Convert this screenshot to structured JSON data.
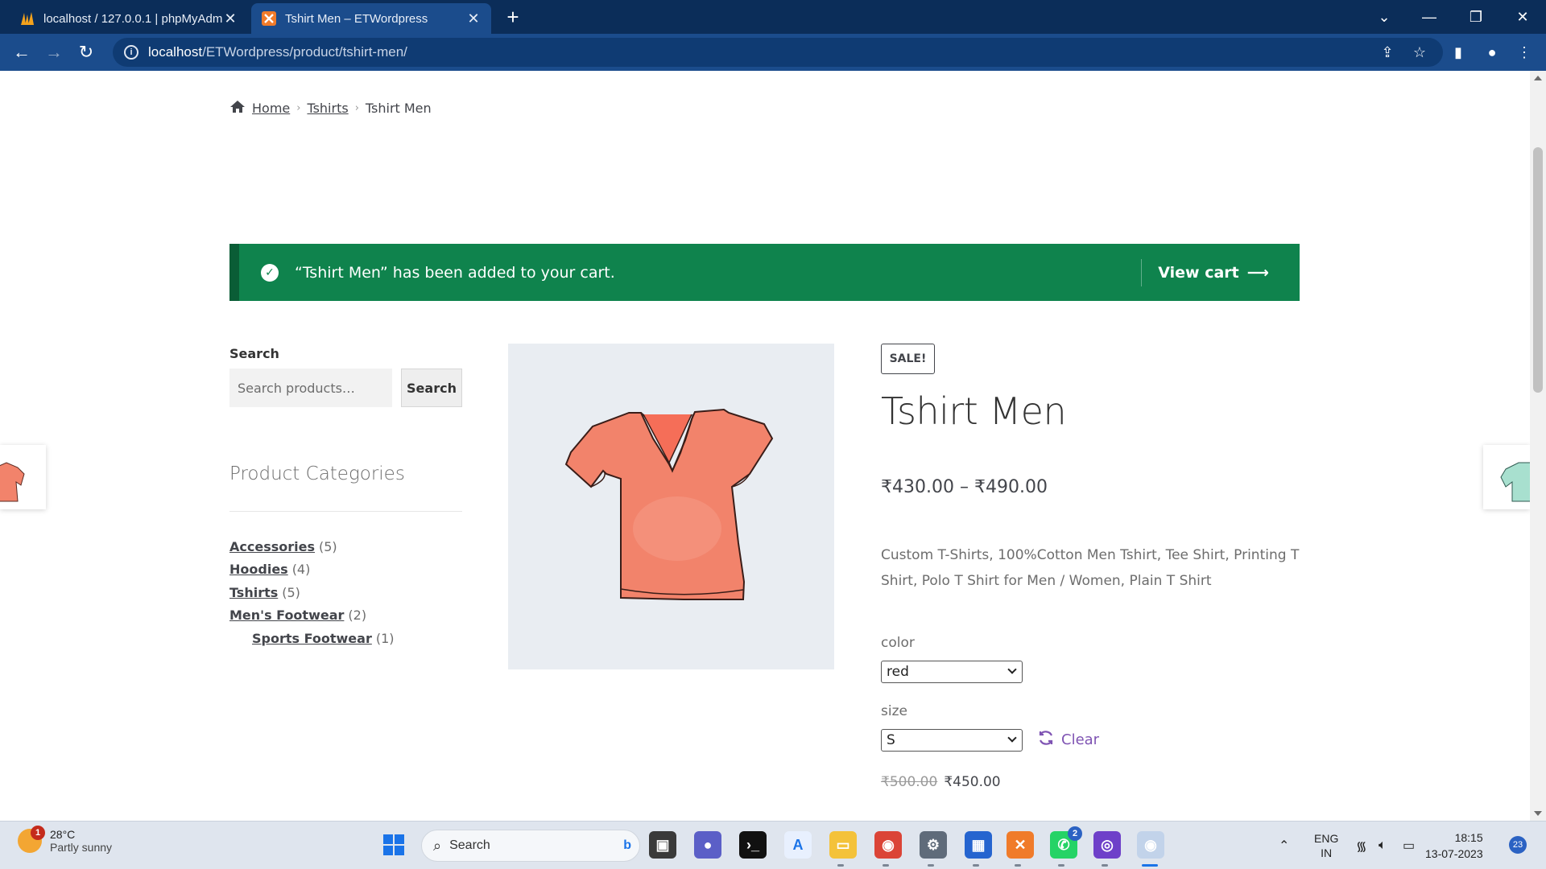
{
  "browser": {
    "tabs": [
      {
        "title": "localhost / 127.0.0.1 | phpMyAdm",
        "close": "✕"
      },
      {
        "title": "Tshirt Men – ETWordpress",
        "close": "✕"
      }
    ],
    "new_tab": "+",
    "url_host": "localhost",
    "url_path": "/ETWordpress/product/tshirt-men/"
  },
  "breadcrumb": {
    "home": "Home",
    "category": "Tshirts",
    "current": "Tshirt Men",
    "separator": "›"
  },
  "notice": {
    "message": "“Tshirt Men” has been added to your cart.",
    "button": "View cart",
    "color": "#0f834d"
  },
  "sidebar": {
    "search_label": "Search",
    "search_placeholder": "Search products…",
    "search_button": "Search",
    "categories_heading": "Product Categories",
    "categories": [
      {
        "name": "Accessories",
        "count": "(5)"
      },
      {
        "name": "Hoodies",
        "count": "(4)"
      },
      {
        "name": "Tshirts",
        "count": "(5)"
      },
      {
        "name": "Men's Footwear",
        "count": "(2)"
      },
      {
        "name": "Sports Footwear",
        "count": "(1)"
      }
    ]
  },
  "product": {
    "badge": "SALE!",
    "title": "Tshirt Men",
    "price_range": "₹430.00 – ₹490.00",
    "description": "Custom T-Shirts, 100%Cotton Men Tshirt, Tee Shirt, Printing T Shirt, Polo T Shirt for Men / Women, Plain T Shirt",
    "color_label": "color",
    "color_value": "red",
    "size_label": "size",
    "size_value": "S",
    "clear": "Clear",
    "old_price": "₹500.00",
    "new_price": "₹450.00",
    "image_color": "#f2836b"
  },
  "taskbar": {
    "weather_temp": "28°C",
    "weather_desc": "Partly sunny",
    "weather_badge": "1",
    "search": "Search",
    "lang_top": "ENG",
    "lang_bottom": "IN",
    "time": "18:15",
    "date": "13-07-2023",
    "notifications": "23",
    "whatsapp_badge": "2"
  }
}
